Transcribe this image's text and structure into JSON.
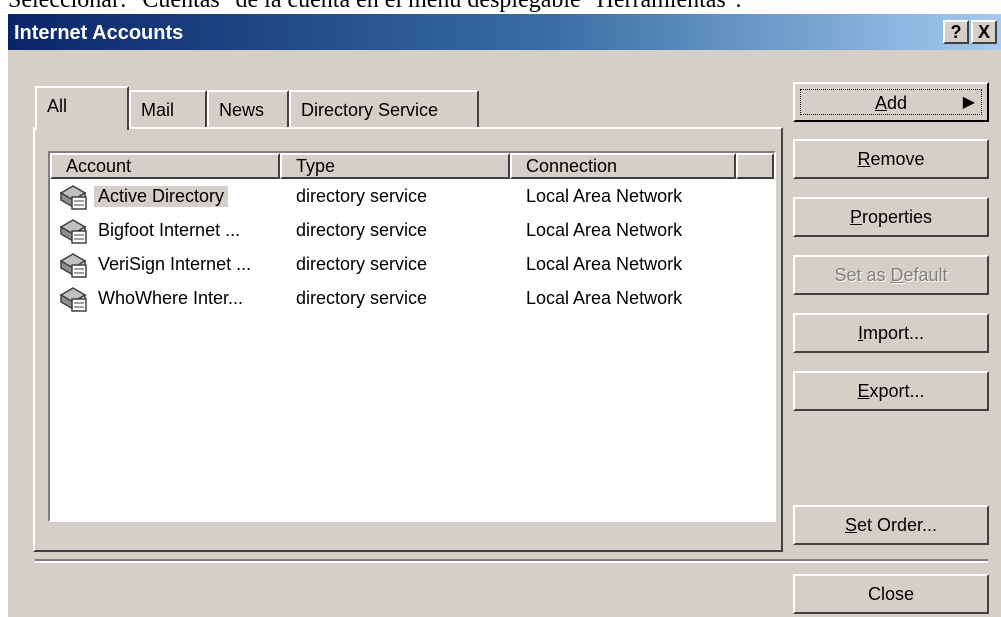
{
  "background_caption": "Seleccionar: \"Cuentas\" de la cuenta en el menú desplegable \"Herramientas\".",
  "window": {
    "title": "Internet Accounts",
    "help_button": "?",
    "close_button": "X"
  },
  "tabs": [
    {
      "label": "All",
      "active": true
    },
    {
      "label": "Mail",
      "active": false
    },
    {
      "label": "News",
      "active": false
    },
    {
      "label": "Directory Service",
      "active": false
    }
  ],
  "list": {
    "columns": [
      "Account",
      "Type",
      "Connection"
    ],
    "rows": [
      {
        "account": "Active Directory",
        "type": "directory service",
        "connection": "Local Area Network",
        "selected": true,
        "icon": "directory-service-icon"
      },
      {
        "account": "Bigfoot Internet ...",
        "type": "directory service",
        "connection": "Local Area Network",
        "selected": false,
        "icon": "directory-service-icon"
      },
      {
        "account": "VeriSign Internet ...",
        "type": "directory service",
        "connection": "Local Area Network",
        "selected": false,
        "icon": "directory-service-icon"
      },
      {
        "account": "WhoWhere Inter...",
        "type": "directory service",
        "connection": "Local Area Network",
        "selected": false,
        "icon": "directory-service-icon"
      }
    ]
  },
  "buttons": {
    "add": {
      "pre": "",
      "key": "A",
      "post": "dd",
      "arrow": "▶"
    },
    "remove": {
      "pre": "",
      "key": "R",
      "post": "emove"
    },
    "properties": {
      "pre": "",
      "key": "P",
      "post": "roperties"
    },
    "set_default": {
      "pre": "Set as ",
      "key": "D",
      "post": "efault",
      "disabled": true
    },
    "import": {
      "pre": "",
      "key": "I",
      "post": "mport..."
    },
    "export": {
      "pre": "",
      "key": "E",
      "post": "xport..."
    },
    "set_order": {
      "pre": "",
      "key": "S",
      "post": "et Order..."
    },
    "close": {
      "label": "Close"
    }
  },
  "colors": {
    "title_gradient_start": "#0a246a",
    "title_gradient_end": "#a6caf0",
    "face": "#d4d0c8"
  }
}
